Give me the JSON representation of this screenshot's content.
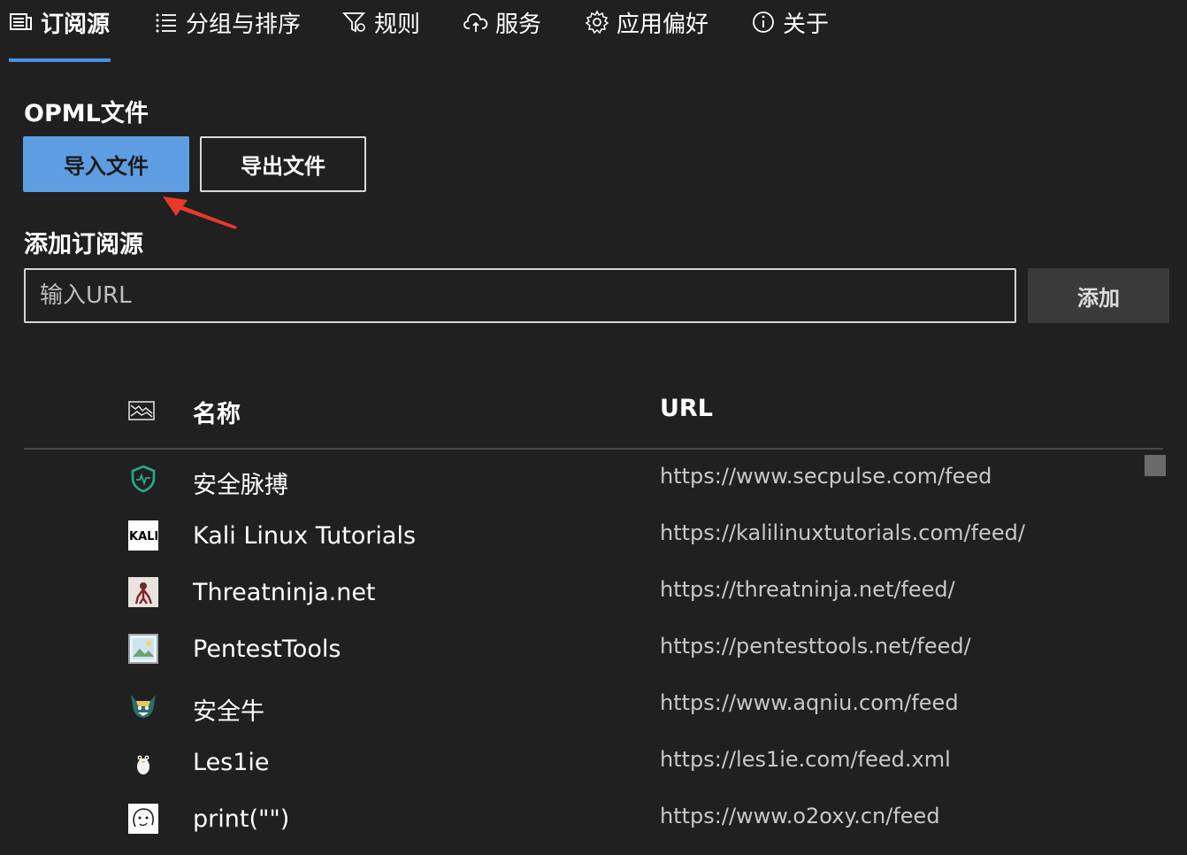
{
  "tabs": [
    {
      "label": "订阅源",
      "icon": "feed-list-icon",
      "active": true
    },
    {
      "label": "分组与排序",
      "icon": "list-icon",
      "active": false
    },
    {
      "label": "规则",
      "icon": "filter-settings-icon",
      "active": false
    },
    {
      "label": "服务",
      "icon": "cloud-sync-icon",
      "active": false
    },
    {
      "label": "应用偏好",
      "icon": "gear-icon",
      "active": false
    },
    {
      "label": "关于",
      "icon": "info-icon",
      "active": false
    }
  ],
  "opml": {
    "title": "OPML文件",
    "import_label": "导入文件",
    "export_label": "导出文件"
  },
  "add_source": {
    "title": "添加订阅源",
    "placeholder": "输入URL",
    "add_label": "添加"
  },
  "colors": {
    "accent": "#4a90e2",
    "primary_button": "#5d9ee3",
    "background": "#202020",
    "annotation_arrow": "#e8392b"
  },
  "table": {
    "icon_column": "image-icon",
    "name_header": "名称",
    "url_header": "URL",
    "rows": [
      {
        "icon": "secpulse-shield-icon",
        "name": "安全脉搏",
        "url": "https://www.secpulse.com/feed"
      },
      {
        "icon": "kali-logo-icon",
        "name": "Kali Linux Tutorials",
        "url": "https://kalilinuxtutorials.com/feed/"
      },
      {
        "icon": "ninja-icon",
        "name": "Threatninja.net",
        "url": "https://threatninja.net/feed/"
      },
      {
        "icon": "image-placeholder-icon",
        "name": "PentestTools",
        "url": "https://pentesttools.net/feed/"
      },
      {
        "icon": "aqniu-mascot-icon",
        "name": "安全牛",
        "url": "https://www.aqniu.com/feed"
      },
      {
        "icon": "penguin-icon",
        "name": "Les1ie",
        "url": "https://les1ie.com/feed.xml"
      },
      {
        "icon": "sketch-face-icon",
        "name": "print(\"\")",
        "url": "https://www.o2oxy.cn/feed"
      }
    ]
  }
}
